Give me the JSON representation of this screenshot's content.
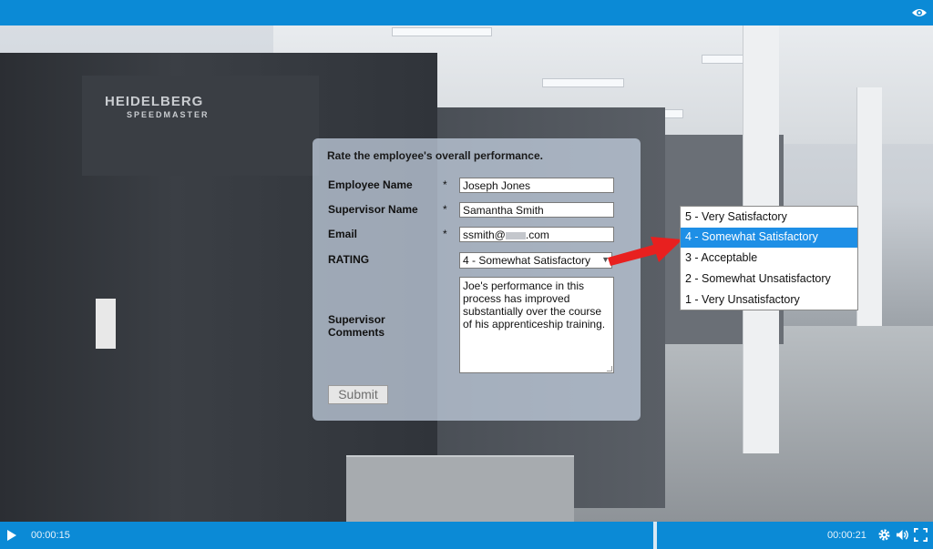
{
  "form": {
    "title": "Rate the employee's overall performance.",
    "required_marker": "*",
    "employee_name": {
      "label": "Employee Name",
      "value": "Joseph Jones"
    },
    "supervisor_name": {
      "label": "Supervisor Name",
      "value": "Samantha Smith"
    },
    "email": {
      "label": "Email",
      "value": "ssmith@",
      "value_suffix": ".com"
    },
    "rating": {
      "label": "RATING",
      "selected": "4 - Somewhat Satisfactory"
    },
    "comments": {
      "label_line1": "Supervisor",
      "label_line2": "Comments",
      "value": "Joe's performance in this process has improved substantially over the course of his apprenticeship training."
    },
    "submit_label": "Submit"
  },
  "rating_options": [
    "5 - Very Satisfactory",
    "4 - Somewhat Satisfactory",
    "3 - Acceptable",
    "2 - Somewhat Unsatisfactory",
    "1 - Very Unsatisfactory"
  ],
  "highlighted_option": "4 - Somewhat Satisfactory",
  "scene": {
    "logo_text": "HEIDELBERG",
    "logo_sub": "SPEEDMASTER"
  },
  "player": {
    "current_time": "00:00:15",
    "total_time": "00:00:21",
    "progress_fraction": 0.7
  },
  "colors": {
    "bar": "#0b8ad6",
    "highlight": "#1e8fe6",
    "arrow": "#e8201f"
  },
  "icons": [
    "eye-icon",
    "play-icon",
    "gear-icon",
    "volume-icon",
    "fullscreen-icon"
  ]
}
